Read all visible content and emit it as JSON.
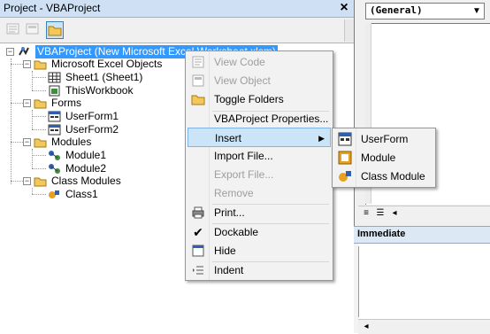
{
  "project_pane": {
    "title": "Project - VBAProject",
    "close_glyph": "×"
  },
  "tree": {
    "root": "VBAProject (New Microsoft Excel Worksheet.xlsm)",
    "folders": [
      {
        "label": "Microsoft Excel Objects",
        "children": [
          "Sheet1 (Sheet1)",
          "ThisWorkbook"
        ]
      },
      {
        "label": "Forms",
        "children": [
          "UserForm1",
          "UserForm2"
        ]
      },
      {
        "label": "Modules",
        "children": [
          "Module1",
          "Module2"
        ]
      },
      {
        "label": "Class Modules",
        "children": [
          "Class1"
        ]
      }
    ]
  },
  "context_menu": {
    "items": [
      {
        "label": "View Code",
        "enabled": false,
        "icon": "view-code-icon"
      },
      {
        "label": "View Object",
        "enabled": false,
        "icon": "view-object-icon"
      },
      {
        "label": "Toggle Folders",
        "enabled": true,
        "icon": "folder-icon"
      },
      {
        "label": "VBAProject Properties...",
        "enabled": true
      },
      {
        "label": "Insert",
        "enabled": true,
        "submenu": true
      },
      {
        "label": "Import File...",
        "enabled": true
      },
      {
        "label": "Export File...",
        "enabled": false
      },
      {
        "label": "Remove",
        "enabled": false
      },
      {
        "label": "Print...",
        "enabled": true,
        "icon": "printer-icon"
      },
      {
        "label": "Dockable",
        "enabled": true,
        "checked": true
      },
      {
        "label": "Hide",
        "enabled": true,
        "icon": "hide-icon"
      },
      {
        "label": "Indent",
        "enabled": true,
        "icon": "indent-icon"
      }
    ]
  },
  "insert_submenu": {
    "items": [
      {
        "label": "UserForm",
        "icon": "userform-icon"
      },
      {
        "label": "Module",
        "icon": "module-icon"
      },
      {
        "label": "Class Module",
        "icon": "class-module-icon"
      }
    ]
  },
  "code_pane": {
    "general_dropdown": "(General)"
  },
  "immediate": {
    "title": "Immediate"
  },
  "colors": {
    "selection": "#3399ff",
    "menu_hover": "#cce4f7",
    "titlebar": "#cfe0f5"
  }
}
